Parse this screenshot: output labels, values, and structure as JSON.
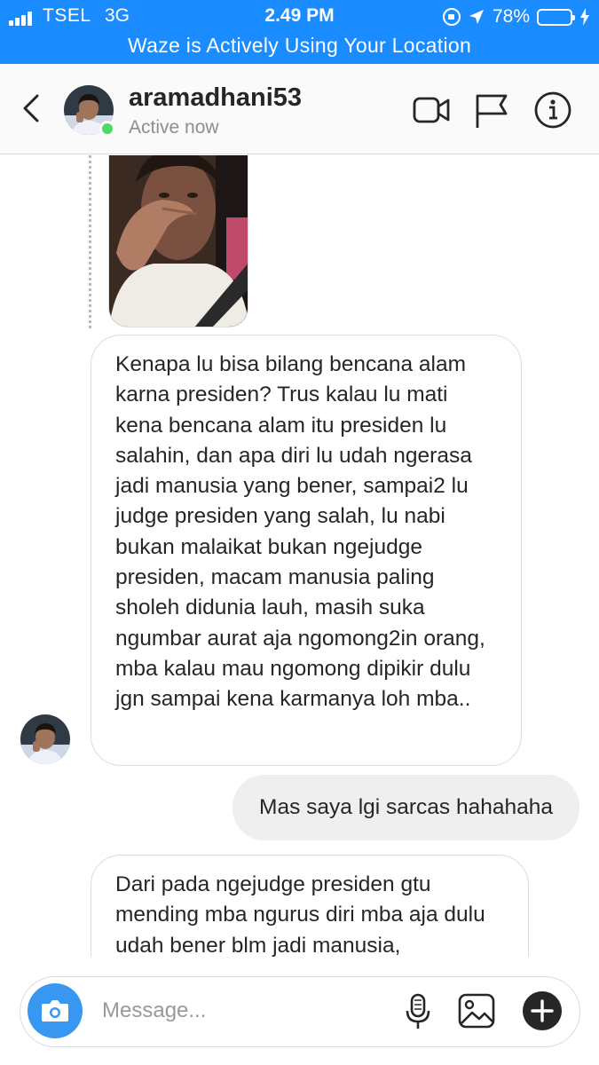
{
  "status_bar": {
    "carrier": "TSEL",
    "network": "3G",
    "time": "2.49 PM",
    "battery": "78%",
    "battery_level": 0.78,
    "banner": "Waze is Actively Using Your Location"
  },
  "header": {
    "username": "aramadhani53",
    "status": "Active now",
    "icons": [
      "back-chevron-icon",
      "video-call-icon",
      "flag-icon",
      "info-icon"
    ]
  },
  "messages": [
    {
      "type": "received",
      "text": "Kenapa lu bisa bilang bencana alam karna presiden? Trus kalau lu mati kena bencana alam itu presiden lu salahin, dan apa diri lu udah ngerasa jadi manusia yang bener, sampai2 lu judge presiden yang salah, lu nabi bukan malaikat bukan ngejudge presiden, macam manusia paling sholeh didunia lauh, masih suka ngumbar aurat aja ngomong2in orang, mba kalau mau ngomong dipikir dulu jgn sampai kena karmanya loh mba.."
    },
    {
      "type": "sent",
      "text": "Mas saya lgi sarcas hahahaha"
    },
    {
      "type": "received",
      "text": "Dari pada ngejudge presiden gtu mending mba ngurus diri mba aja dulu udah bener blm jadi manusia,"
    }
  ],
  "composer": {
    "placeholder": "Message...",
    "icons": [
      "camera-icon",
      "microphone-icon",
      "gallery-icon",
      "plus-icon"
    ]
  },
  "colors": {
    "status_bar": "#1a8cff",
    "camera_button": "#3897f0",
    "online": "#4cd964",
    "sent_bubble": "#efefef"
  }
}
